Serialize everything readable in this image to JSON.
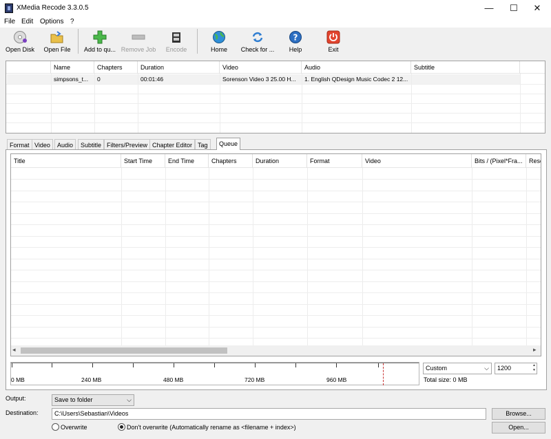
{
  "window": {
    "title": "XMedia Recode 3.3.0.5",
    "minimize": "—",
    "maximize": "☐",
    "close": "✕"
  },
  "menu": [
    "File",
    "Edit",
    "Options",
    "?"
  ],
  "toolbar": {
    "open_disk": "Open Disk",
    "open_file": "Open File",
    "add_queue": "Add to qu...",
    "remove_job": "Remove Job",
    "encode": "Encode",
    "home": "Home",
    "check_for": "Check for ...",
    "help": "Help",
    "exit": "Exit"
  },
  "files": {
    "headers": [
      "Name",
      "Chapters",
      "Duration",
      "Video",
      "Audio",
      "Subtitle"
    ],
    "row": [
      "simpsons_t...",
      "0",
      "00:01:46",
      "Sorenson Video 3 25.00 H...",
      "1. English QDesign Music Codec 2 12...",
      ""
    ]
  },
  "tabs": [
    "Format",
    "Video",
    "Audio",
    "Subtitle",
    "Filters/Preview",
    "Chapter Editor",
    "Tag",
    "Queue"
  ],
  "queue": {
    "headers": [
      "Title",
      "Start Time",
      "End Time",
      "Chapters",
      "Duration",
      "Format",
      "Video",
      "Bits / (Pixel*Fra...",
      "Reso"
    ]
  },
  "size_bar": {
    "labels": [
      "0 MB",
      "240 MB",
      "480 MB",
      "720 MB",
      "960 MB"
    ],
    "preset": "Custom",
    "value": "1200",
    "total": "Total size: 0 MB",
    "dropdown_arrow": "⌵",
    "spin_up": "▲",
    "spin_down": "▼"
  },
  "output": {
    "label": "Output:",
    "value": "Save to folder",
    "dest_label": "Destination:",
    "dest_value": "C:\\Users\\Sebastian\\Videos",
    "browse": "Browse...",
    "open": "Open...",
    "overwrite": "Overwrite",
    "dont_overwrite": "Don't overwrite (Automatically rename as <filename + index>)"
  },
  "scroll": {
    "left": "◂",
    "right": "▸"
  }
}
